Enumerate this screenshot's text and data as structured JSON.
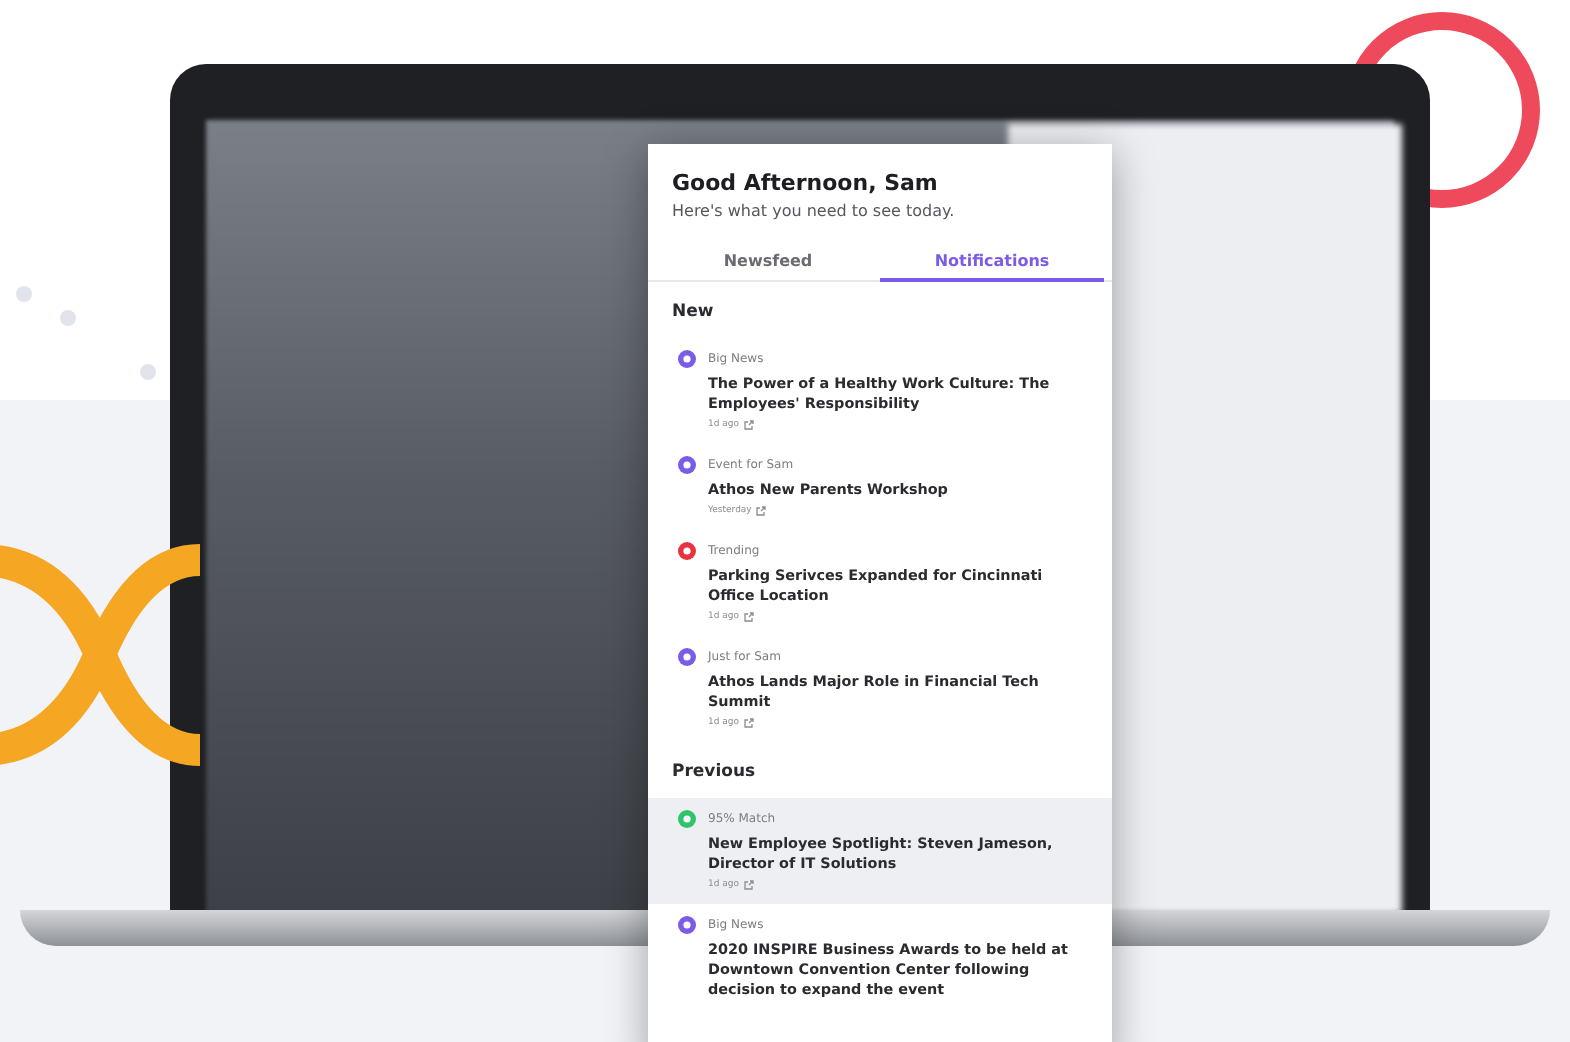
{
  "greeting": {
    "title": "Good Afternoon, Sam",
    "subtitle": "Here's what you need to see today."
  },
  "tabs": [
    {
      "label": "Newsfeed",
      "selected": false
    },
    {
      "label": "Notifications",
      "selected": true
    }
  ],
  "sections": [
    {
      "heading": "New",
      "items": [
        {
          "category": "Big News",
          "color": "#7b5ce6",
          "title": "The Power of a Healthy Work Culture: The Employees' Responsibility",
          "time": "1d ago",
          "selected": false
        },
        {
          "category": "Event for Sam",
          "color": "#7b5ce6",
          "title": "Athos New Parents Workshop",
          "time": "Yesterday",
          "selected": false
        },
        {
          "category": "Trending",
          "color": "#e8333f",
          "title": "Parking Serivces Expanded for Cincinnati Office Location",
          "time": "1d ago",
          "selected": false
        },
        {
          "category": "Just for Sam",
          "color": "#7b5ce6",
          "title": "Athos Lands Major Role in Financial Tech Summit",
          "time": "1d ago",
          "selected": false
        }
      ]
    },
    {
      "heading": "Previous",
      "items": [
        {
          "category": "95% Match",
          "color": "#2fc46a",
          "title": "New Employee Spotlight: Steven Jameson, Director of IT Solutions",
          "time": "1d ago",
          "selected": true
        },
        {
          "category": "Big News",
          "color": "#7b5ce6",
          "title": "2020 INSPIRE Business Awards to be held at Downtown Convention Center following decision to expand the event",
          "selected": false
        }
      ]
    }
  ]
}
